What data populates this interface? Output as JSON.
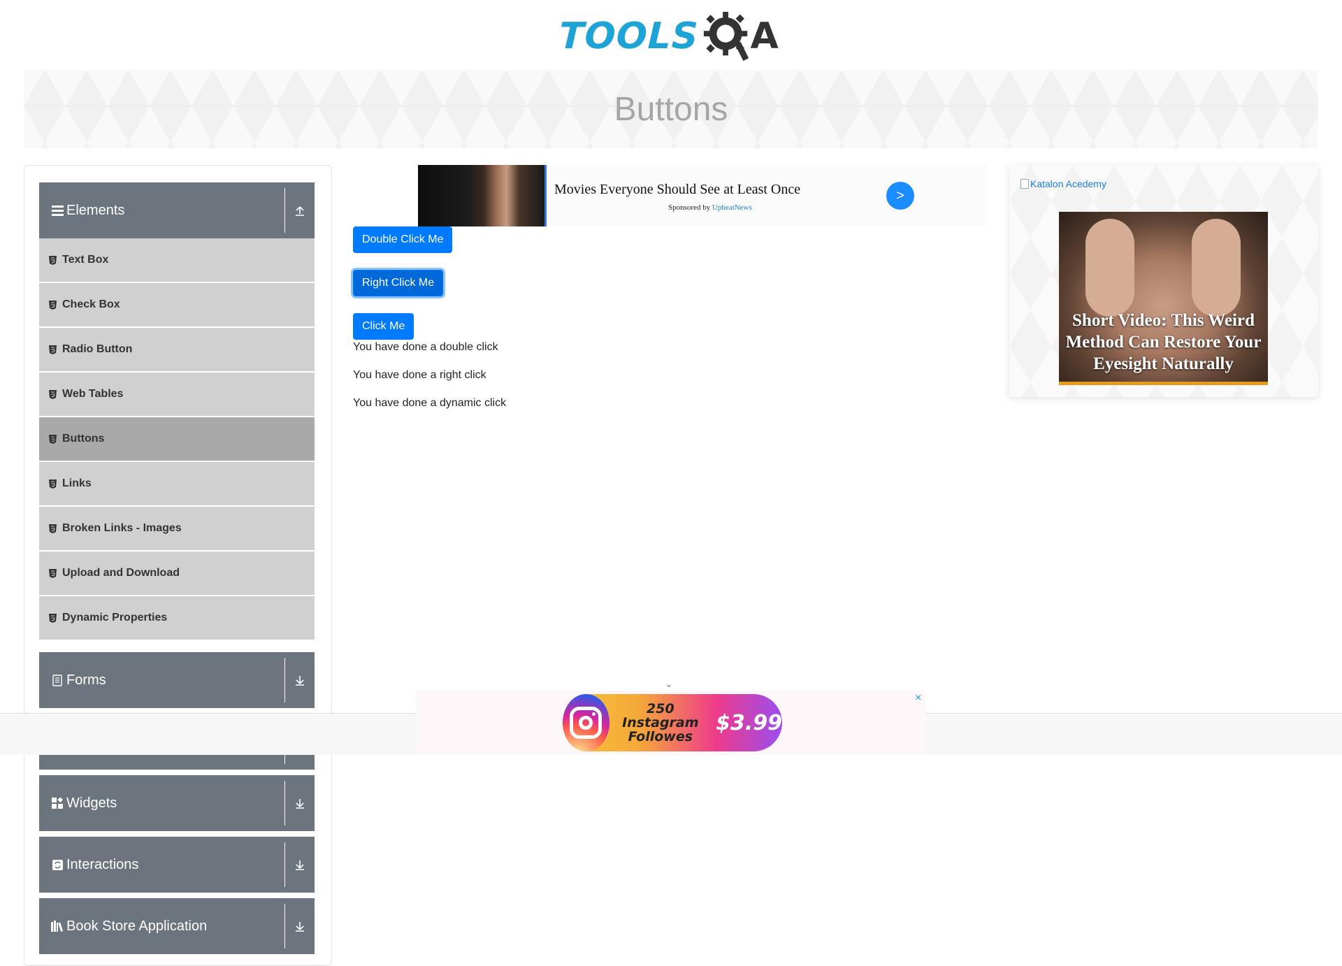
{
  "header": {
    "logo_part1": "TOOLS",
    "logo_part2": "A",
    "logo_icon": "gear-magnifier-icon"
  },
  "banner": {
    "title": "Buttons"
  },
  "sidebar": {
    "groups": [
      {
        "title": "Elements",
        "icon": "hamburger-icon",
        "toggle_icon": "collapse-up-icon"
      },
      {
        "title": "Forms",
        "icon": "document-icon",
        "toggle_icon": "expand-down-icon"
      },
      {
        "title": "Widgets",
        "icon": "widgets-icon",
        "toggle_icon": "expand-down-icon"
      },
      {
        "title": "Interactions",
        "icon": "interactions-icon",
        "toggle_icon": "expand-down-icon"
      },
      {
        "title": "Book Store Application",
        "icon": "books-icon",
        "toggle_icon": "expand-down-icon"
      }
    ],
    "items": [
      {
        "label": "Text Box"
      },
      {
        "label": "Check Box"
      },
      {
        "label": "Radio Button"
      },
      {
        "label": "Web Tables"
      },
      {
        "label": "Buttons",
        "active": true
      },
      {
        "label": "Links"
      },
      {
        "label": "Broken Links - Images"
      },
      {
        "label": "Upload and Download"
      },
      {
        "label": "Dynamic Properties"
      }
    ]
  },
  "top_ad": {
    "headline": "Movies Everyone Should See at Least Once",
    "sponsor_prefix": "Sponsored by",
    "sponsor_name": "UpbeatNews",
    "arrow": ">"
  },
  "buttons": {
    "double_click": "Double Click Me",
    "right_click": "Right Click Me",
    "click": "Click Me"
  },
  "messages": {
    "double": "You have done a double click",
    "right": "You have done a right click",
    "dynamic": "You have done a dynamic click"
  },
  "right_ad": {
    "link_text": "Katalon Acedemy",
    "caption": "Short Video: This Weird Method Can Restore Your Eyesight Naturally"
  },
  "bottom_ad": {
    "line1": "250 Instagram",
    "line2": "Followes",
    "price": "$3.99",
    "close": "×",
    "chevron": "⌄"
  },
  "colors": {
    "primary": "#007bff",
    "sidebar_header": "#6c757d",
    "menu_item": "#d0d0d0",
    "menu_item_active": "#a9a9a9",
    "logo_blue": "#1ea3d6"
  }
}
